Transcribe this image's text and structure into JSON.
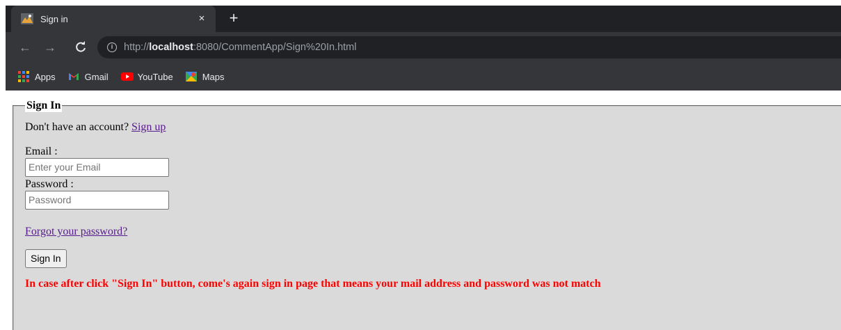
{
  "browser": {
    "tab_title": "Sign in",
    "tab_close": "×",
    "new_tab": "+",
    "url_prefix": "http://",
    "url_host": "localhost",
    "url_path": ":8080/CommentApp/Sign%20In.html",
    "bookmarks": [
      "Apps",
      "Gmail",
      "YouTube",
      "Maps"
    ]
  },
  "form": {
    "legend": "Sign In",
    "no_account_text": "Don't have an account?",
    "signup_link": "Sign up",
    "email_label": "Email :",
    "email_placeholder": "Enter your Email",
    "password_label": "Password :",
    "password_placeholder": "Password",
    "forgot_link": "Forgot your password?",
    "submit_label": "Sign In",
    "notice": "In case after click \"Sign In\" button, come's again sign in page that means your mail address and password was not match"
  },
  "colors": {
    "fieldset_bg": "#dadada",
    "notice": "#ff0000",
    "link": "#551a8b"
  }
}
